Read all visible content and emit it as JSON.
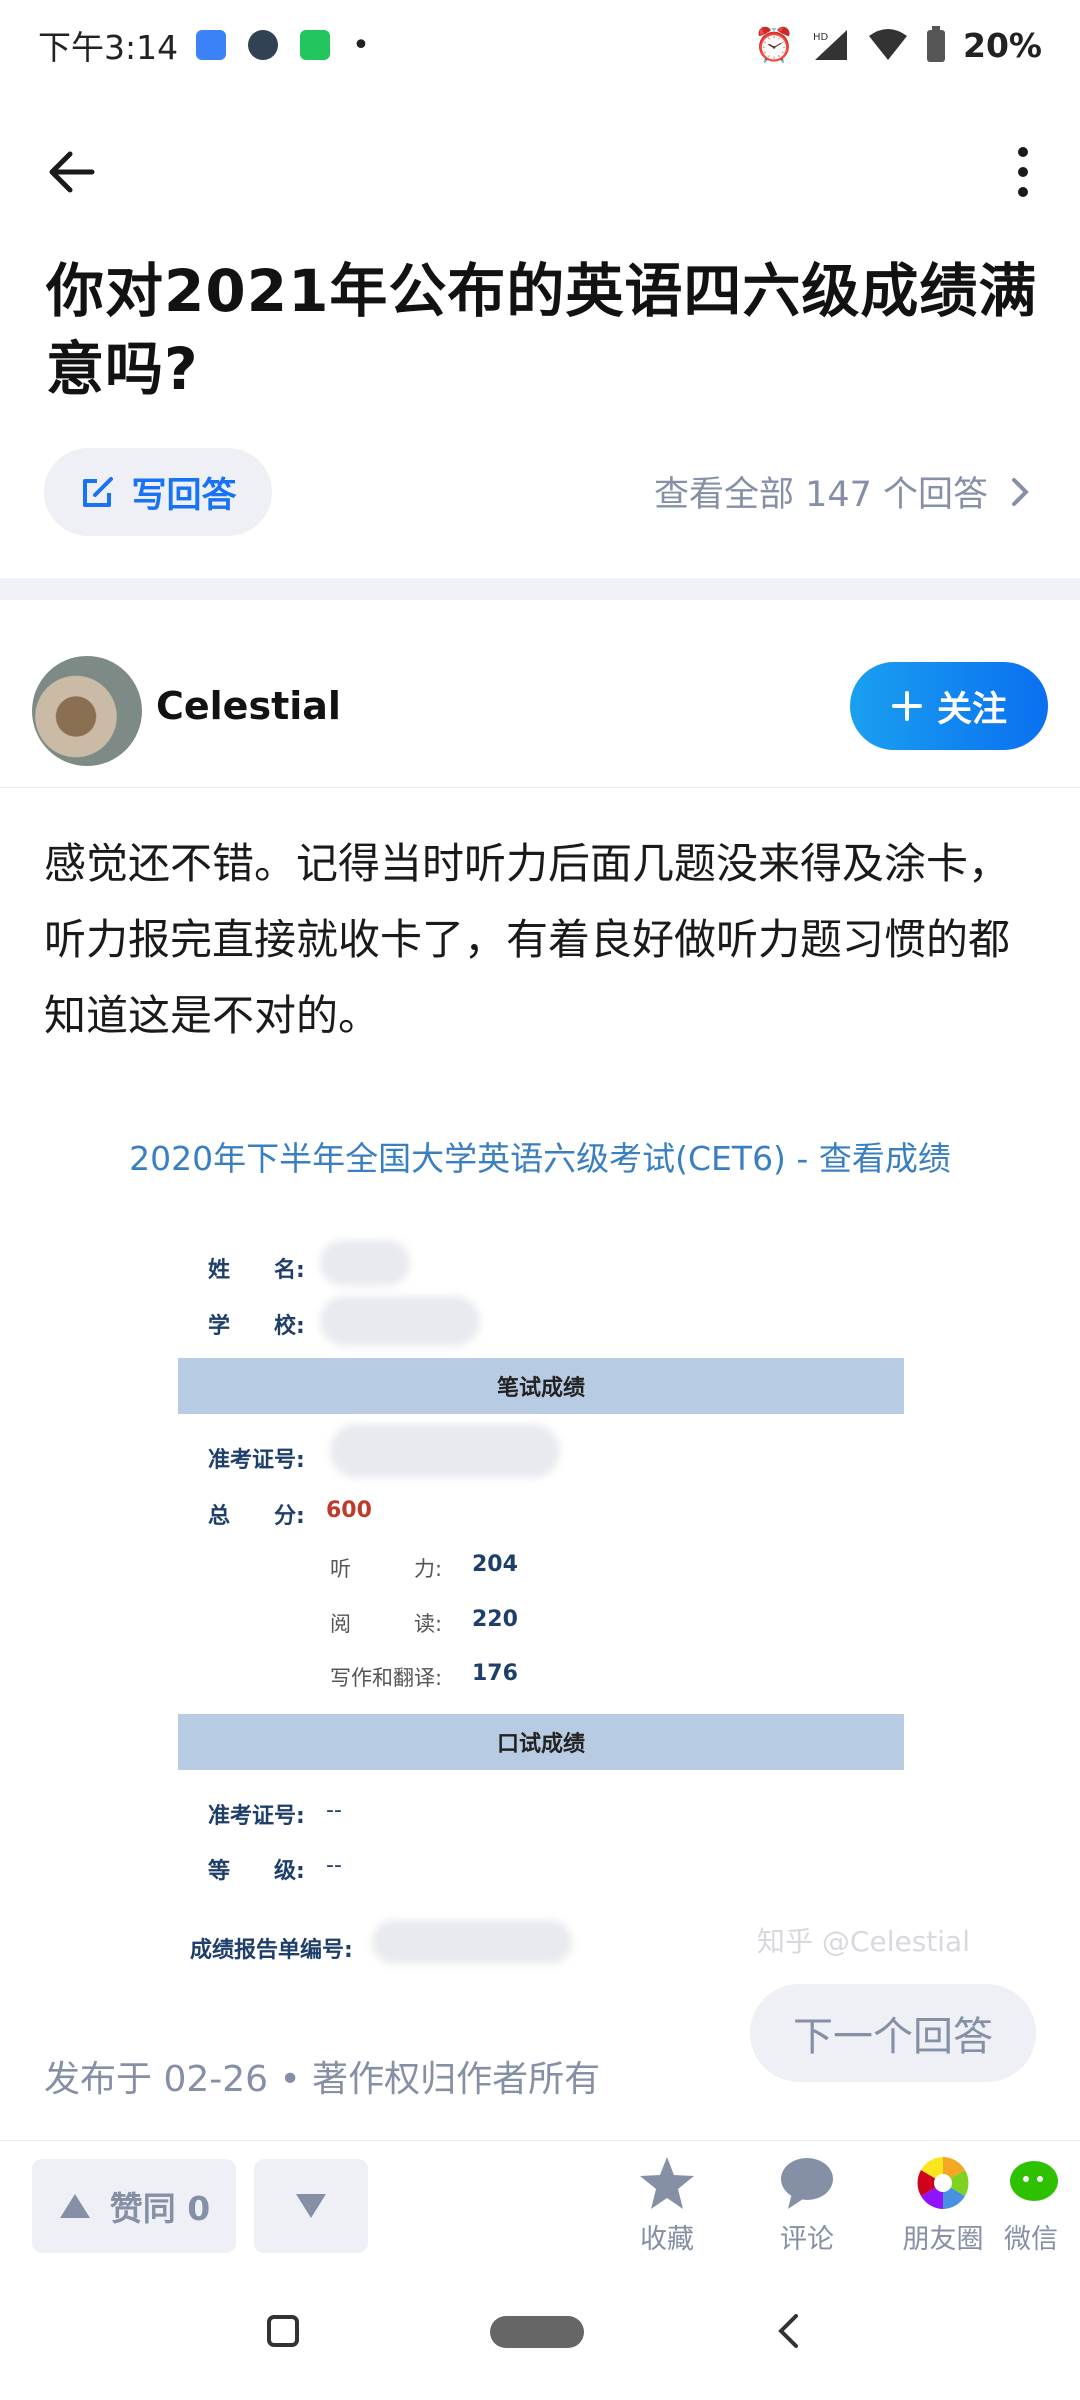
{
  "status_bar": {
    "time": "下午3:14",
    "battery": "20%"
  },
  "question": {
    "title": "你对2021年公布的英语四六级成绩满意吗?"
  },
  "actions": {
    "write_answer": "写回答",
    "view_all": "查看全部 147 个回答"
  },
  "author": {
    "name": "Celestial",
    "follow": "关注"
  },
  "answer": {
    "text": "感觉还不错。记得当时听力后面几题没来得及涂卡，听力报完直接就收卡了，有着良好做听力题习惯的都知道这是不对的。",
    "published": "发布于 02-26 • 著作权归作者所有",
    "next": "下一个回答"
  },
  "score_image": {
    "title": "2020年下半年全国大学英语六级考试(CET6) - 查看成绩",
    "name_label": "姓　　名:",
    "school_label": "学　　校:",
    "written_header": "笔试成绩",
    "ticket_label": "准考证号:",
    "total_label": "总　　分:",
    "total_value": "600",
    "listening_label": "听　　　力:",
    "listening_value": "204",
    "reading_label": "阅　　　读:",
    "reading_value": "220",
    "writing_label": "写作和翻译:",
    "writing_value": "176",
    "oral_header": "口试成绩",
    "oral_ticket_label": "准考证号:",
    "oral_ticket_value": "--",
    "grade_label": "等　　级:",
    "grade_value": "--",
    "report_label": "成绩报告单编号:",
    "watermark": "知乎 @Celestial"
  },
  "action_bar": {
    "agree": "赞同 0",
    "favorite": "收藏",
    "comment": "评论",
    "moments": "朋友圈",
    "wechat": "微信"
  }
}
